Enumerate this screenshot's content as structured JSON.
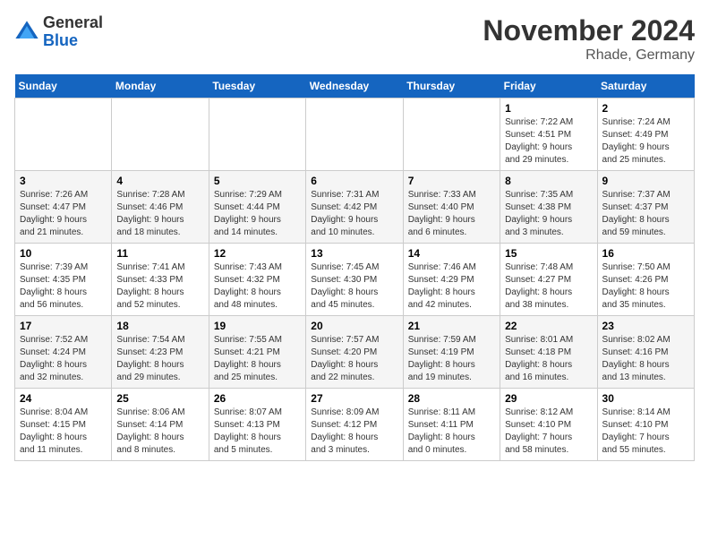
{
  "header": {
    "logo_line1": "General",
    "logo_line2": "Blue",
    "title": "November 2024",
    "subtitle": "Rhade, Germany"
  },
  "calendar": {
    "days_of_week": [
      "Sunday",
      "Monday",
      "Tuesday",
      "Wednesday",
      "Thursday",
      "Friday",
      "Saturday"
    ],
    "weeks": [
      [
        {
          "day": "",
          "info": ""
        },
        {
          "day": "",
          "info": ""
        },
        {
          "day": "",
          "info": ""
        },
        {
          "day": "",
          "info": ""
        },
        {
          "day": "",
          "info": ""
        },
        {
          "day": "1",
          "info": "Sunrise: 7:22 AM\nSunset: 4:51 PM\nDaylight: 9 hours\nand 29 minutes."
        },
        {
          "day": "2",
          "info": "Sunrise: 7:24 AM\nSunset: 4:49 PM\nDaylight: 9 hours\nand 25 minutes."
        }
      ],
      [
        {
          "day": "3",
          "info": "Sunrise: 7:26 AM\nSunset: 4:47 PM\nDaylight: 9 hours\nand 21 minutes."
        },
        {
          "day": "4",
          "info": "Sunrise: 7:28 AM\nSunset: 4:46 PM\nDaylight: 9 hours\nand 18 minutes."
        },
        {
          "day": "5",
          "info": "Sunrise: 7:29 AM\nSunset: 4:44 PM\nDaylight: 9 hours\nand 14 minutes."
        },
        {
          "day": "6",
          "info": "Sunrise: 7:31 AM\nSunset: 4:42 PM\nDaylight: 9 hours\nand 10 minutes."
        },
        {
          "day": "7",
          "info": "Sunrise: 7:33 AM\nSunset: 4:40 PM\nDaylight: 9 hours\nand 6 minutes."
        },
        {
          "day": "8",
          "info": "Sunrise: 7:35 AM\nSunset: 4:38 PM\nDaylight: 9 hours\nand 3 minutes."
        },
        {
          "day": "9",
          "info": "Sunrise: 7:37 AM\nSunset: 4:37 PM\nDaylight: 8 hours\nand 59 minutes."
        }
      ],
      [
        {
          "day": "10",
          "info": "Sunrise: 7:39 AM\nSunset: 4:35 PM\nDaylight: 8 hours\nand 56 minutes."
        },
        {
          "day": "11",
          "info": "Sunrise: 7:41 AM\nSunset: 4:33 PM\nDaylight: 8 hours\nand 52 minutes."
        },
        {
          "day": "12",
          "info": "Sunrise: 7:43 AM\nSunset: 4:32 PM\nDaylight: 8 hours\nand 48 minutes."
        },
        {
          "day": "13",
          "info": "Sunrise: 7:45 AM\nSunset: 4:30 PM\nDaylight: 8 hours\nand 45 minutes."
        },
        {
          "day": "14",
          "info": "Sunrise: 7:46 AM\nSunset: 4:29 PM\nDaylight: 8 hours\nand 42 minutes."
        },
        {
          "day": "15",
          "info": "Sunrise: 7:48 AM\nSunset: 4:27 PM\nDaylight: 8 hours\nand 38 minutes."
        },
        {
          "day": "16",
          "info": "Sunrise: 7:50 AM\nSunset: 4:26 PM\nDaylight: 8 hours\nand 35 minutes."
        }
      ],
      [
        {
          "day": "17",
          "info": "Sunrise: 7:52 AM\nSunset: 4:24 PM\nDaylight: 8 hours\nand 32 minutes."
        },
        {
          "day": "18",
          "info": "Sunrise: 7:54 AM\nSunset: 4:23 PM\nDaylight: 8 hours\nand 29 minutes."
        },
        {
          "day": "19",
          "info": "Sunrise: 7:55 AM\nSunset: 4:21 PM\nDaylight: 8 hours\nand 25 minutes."
        },
        {
          "day": "20",
          "info": "Sunrise: 7:57 AM\nSunset: 4:20 PM\nDaylight: 8 hours\nand 22 minutes."
        },
        {
          "day": "21",
          "info": "Sunrise: 7:59 AM\nSunset: 4:19 PM\nDaylight: 8 hours\nand 19 minutes."
        },
        {
          "day": "22",
          "info": "Sunrise: 8:01 AM\nSunset: 4:18 PM\nDaylight: 8 hours\nand 16 minutes."
        },
        {
          "day": "23",
          "info": "Sunrise: 8:02 AM\nSunset: 4:16 PM\nDaylight: 8 hours\nand 13 minutes."
        }
      ],
      [
        {
          "day": "24",
          "info": "Sunrise: 8:04 AM\nSunset: 4:15 PM\nDaylight: 8 hours\nand 11 minutes."
        },
        {
          "day": "25",
          "info": "Sunrise: 8:06 AM\nSunset: 4:14 PM\nDaylight: 8 hours\nand 8 minutes."
        },
        {
          "day": "26",
          "info": "Sunrise: 8:07 AM\nSunset: 4:13 PM\nDaylight: 8 hours\nand 5 minutes."
        },
        {
          "day": "27",
          "info": "Sunrise: 8:09 AM\nSunset: 4:12 PM\nDaylight: 8 hours\nand 3 minutes."
        },
        {
          "day": "28",
          "info": "Sunrise: 8:11 AM\nSunset: 4:11 PM\nDaylight: 8 hours\nand 0 minutes."
        },
        {
          "day": "29",
          "info": "Sunrise: 8:12 AM\nSunset: 4:10 PM\nDaylight: 7 hours\nand 58 minutes."
        },
        {
          "day": "30",
          "info": "Sunrise: 8:14 AM\nSunset: 4:10 PM\nDaylight: 7 hours\nand 55 minutes."
        }
      ]
    ]
  }
}
